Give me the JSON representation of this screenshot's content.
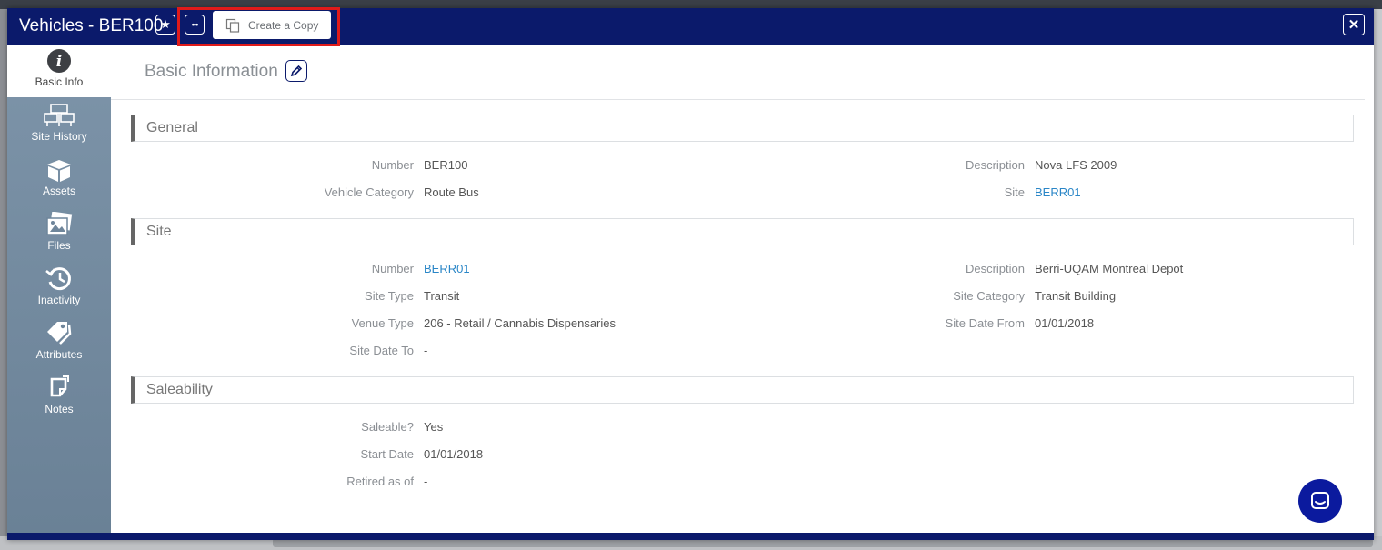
{
  "window": {
    "title": "Vehicles - BER100",
    "copy_label": "Create a Copy",
    "close_glyph": "✕",
    "star_glyph": "★",
    "more_glyph": "•••"
  },
  "sidebar": {
    "items": [
      {
        "label": "Basic Info",
        "icon": "info-icon"
      },
      {
        "label": "Site History",
        "icon": "site-history-icon"
      },
      {
        "label": "Assets",
        "icon": "box-icon"
      },
      {
        "label": "Files",
        "icon": "images-icon"
      },
      {
        "label": "Inactivity",
        "icon": "history-icon"
      },
      {
        "label": "Attributes",
        "icon": "tags-icon"
      },
      {
        "label": "Notes",
        "icon": "note-icon"
      }
    ]
  },
  "page": {
    "title": "Basic Information"
  },
  "sections": {
    "general": {
      "title": "General",
      "number_label": "Number",
      "number": "BER100",
      "vehicle_category_label": "Vehicle Category",
      "vehicle_category": "Route Bus",
      "description_label": "Description",
      "description": "Nova LFS 2009",
      "site_label": "Site",
      "site": "BERR01"
    },
    "site": {
      "title": "Site",
      "number_label": "Number",
      "number": "BERR01",
      "site_type_label": "Site Type",
      "site_type": "Transit",
      "venue_type_label": "Venue Type",
      "venue_type": "206 - Retail / Cannabis Dispensaries",
      "site_date_to_label": "Site Date To",
      "site_date_to": "-",
      "description_label": "Description",
      "description": "Berri-UQAM Montreal Depot",
      "site_category_label": "Site Category",
      "site_category": "Transit Building",
      "site_date_from_label": "Site Date From",
      "site_date_from": "01/01/2018"
    },
    "saleability": {
      "title": "Saleability",
      "saleable_label": "Saleable?",
      "saleable": "Yes",
      "start_date_label": "Start Date",
      "start_date": "01/01/2018",
      "retired_label": "Retired as of",
      "retired": "-"
    }
  },
  "colors": {
    "titlebar": "#0b1a6b",
    "link": "#2a86c7",
    "highlight": "#e01a1a"
  }
}
